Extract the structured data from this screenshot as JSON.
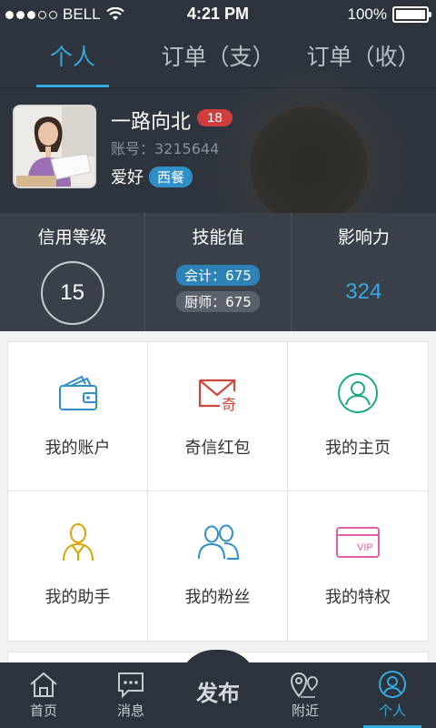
{
  "status_bar": {
    "carrier": "BELL",
    "time": "4:21 PM",
    "battery": "100%"
  },
  "tabs": [
    {
      "label": "个人",
      "active": true
    },
    {
      "label": "订单（支）",
      "active": false
    },
    {
      "label": "订单（收）",
      "active": false
    }
  ],
  "profile": {
    "name": "一路向北",
    "age": "18",
    "account": "账号：3215644",
    "hobby_label": "爱好",
    "hobby_tag": "西餐"
  },
  "stats": {
    "credit": {
      "title": "信用等级",
      "value": "15"
    },
    "skills": {
      "title": "技能值",
      "items": [
        "会计：675",
        "厨师：675"
      ]
    },
    "influence": {
      "title": "影响力",
      "value": "324"
    }
  },
  "grid": [
    {
      "label": "我的账户",
      "icon": "wallet-icon",
      "color": "#2e8fc9"
    },
    {
      "label": "奇信红包",
      "icon": "envelope-icon",
      "color": "#d1463b"
    },
    {
      "label": "我的主页",
      "icon": "user-circle-icon",
      "color": "#19a97b"
    },
    {
      "label": "我的助手",
      "icon": "assistant-icon",
      "color": "#d9a300"
    },
    {
      "label": "我的粉丝",
      "icon": "fans-icon",
      "color": "#2e8fc9"
    },
    {
      "label": "我的特权",
      "icon": "vip-card-icon",
      "color": "#e05fa8"
    }
  ],
  "nav": {
    "items": [
      {
        "label": "首页",
        "icon": "home-icon"
      },
      {
        "label": "消息",
        "icon": "message-icon"
      },
      {
        "label": "附近",
        "icon": "location-icon"
      },
      {
        "label": "个人",
        "icon": "profile-icon",
        "active": true
      }
    ],
    "publish": "发布"
  },
  "colors": {
    "accent": "#35a8e0",
    "header_bg": "#2e343d",
    "badge_red": "#cf3d3d"
  }
}
